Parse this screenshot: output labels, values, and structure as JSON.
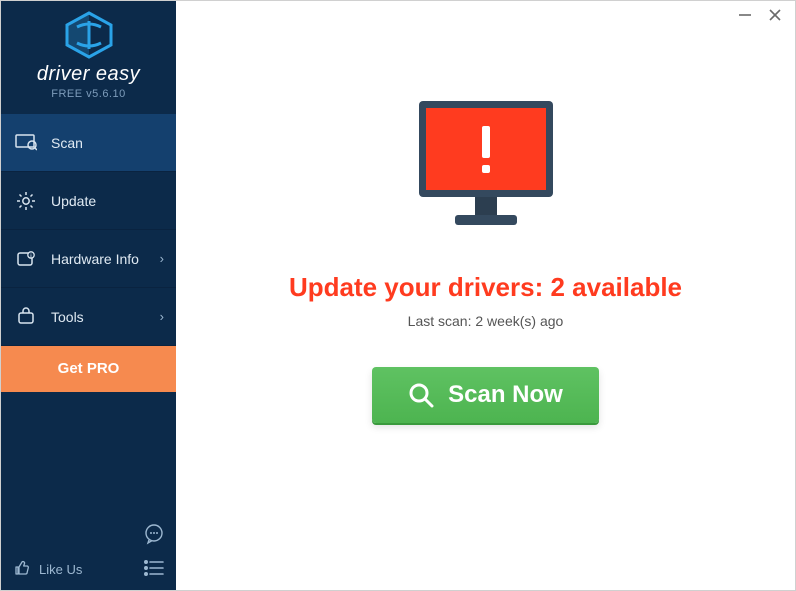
{
  "brand": {
    "name": "driver easy",
    "version": "FREE v5.6.10"
  },
  "sidebar": {
    "items": [
      {
        "label": "Scan"
      },
      {
        "label": "Update"
      },
      {
        "label": "Hardware Info"
      },
      {
        "label": "Tools"
      }
    ],
    "getpro_label": "Get PRO",
    "likeus_label": "Like Us"
  },
  "main": {
    "headline": "Update your drivers: 2 available",
    "subline": "Last scan: 2 week(s) ago",
    "scan_button": "Scan Now"
  },
  "colors": {
    "accent_orange": "#f68a4f",
    "alert_red": "#ff3b1f",
    "scan_green": "#4db450",
    "sidebar_bg": "#0c2a4a"
  }
}
